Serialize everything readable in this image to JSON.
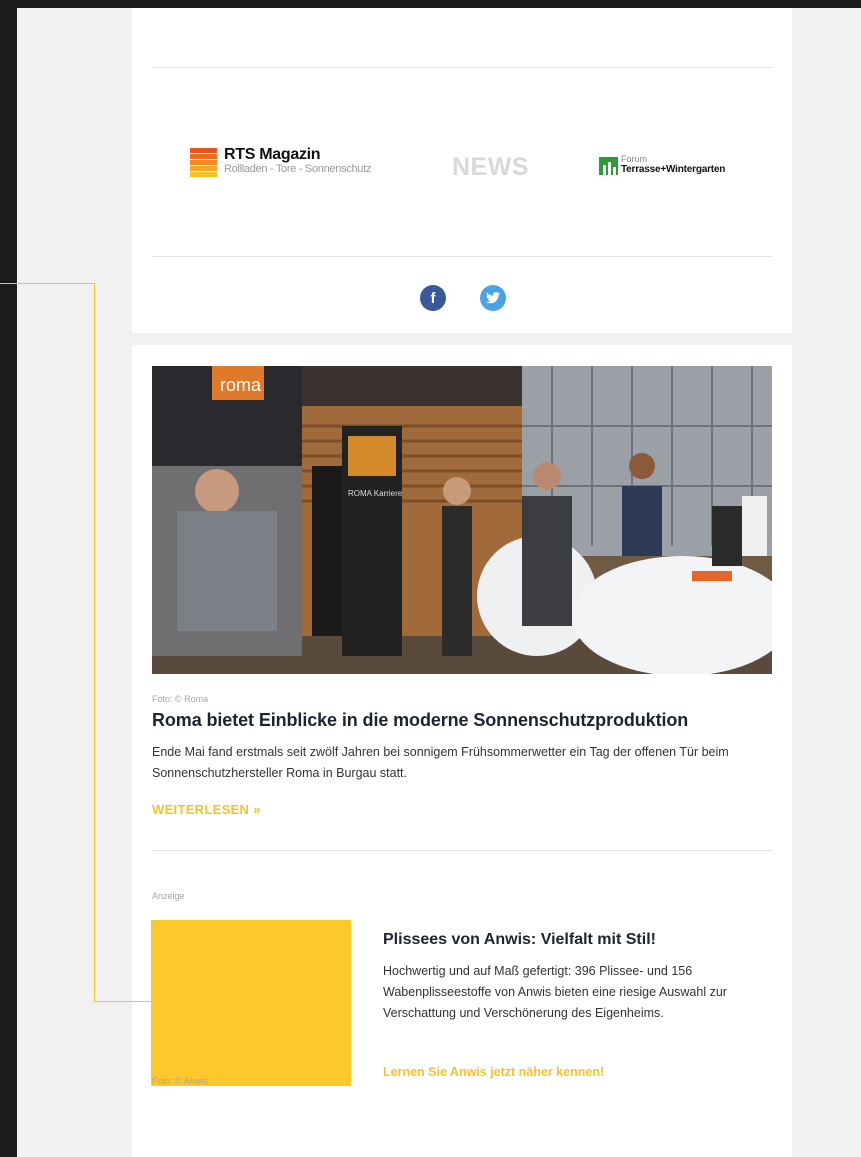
{
  "header": {
    "logo_rts_title": "RTS Magazin",
    "logo_rts_subtitle": "Rollladen - Tore - Sonnenschutz",
    "logo_news": "NEWS",
    "logo_forum_small": "Forum",
    "logo_forum_large": "Terrasse+Wintergarten",
    "social": {
      "facebook_glyph": "f",
      "twitter_glyph": "t"
    }
  },
  "article": {
    "photo_credit": "Foto: © Roma",
    "headline": "Roma bietet Einblicke in die moderne Sonnenschutzproduktion",
    "lead": "Ende Mai fand erstmals seit zwölf Jahren bei sonnigem Frühsommerwetter ein Tag der offenen Tür beim Sonnenschutzhersteller Roma in Burgau statt.",
    "read_more": "WEITERLESEN »",
    "hero_sign": "roma",
    "hero_banner": "ROMA Karriere"
  },
  "ad": {
    "label": "Anzeige",
    "photo_credit": "Foto: © Anwis",
    "title": "Plissees von Anwis: Vielfalt mit Stil!",
    "text": "Hochwertig und auf Maß gefertigt: 396 Plissee- und 156 Wabenplisseestoffe von Anwis bieten eine riesige Auswahl zur Verschattung und Verschönerung des Eigenheims.",
    "link": "Lernen Sie Anwis jetzt näher kennen!"
  },
  "colors": {
    "accent": "#f6c22c",
    "ad_block": "#fdc82b",
    "facebook": "#3b5998",
    "twitter": "#4ba3e6"
  },
  "icons": [
    "rts-magazin-logo",
    "forum-logo",
    "facebook-icon",
    "twitter-icon"
  ]
}
